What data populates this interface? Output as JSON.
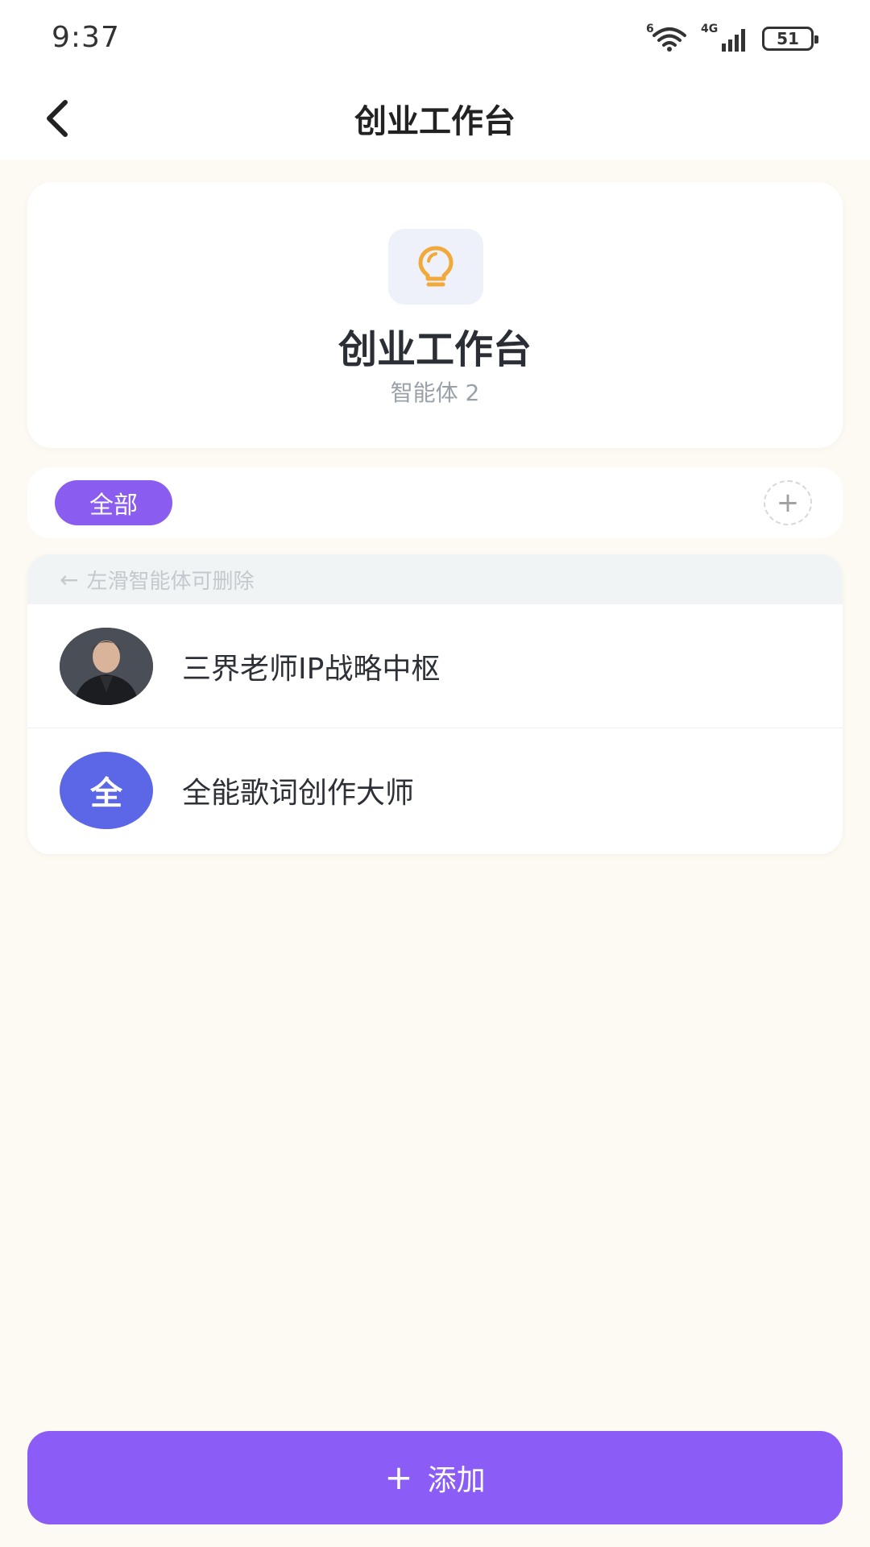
{
  "status_bar": {
    "time": "9:37",
    "wifi_label": "6",
    "network_label": "4G",
    "battery": "51"
  },
  "header": {
    "title": "创业工作台",
    "back_icon": "chevron-left-icon"
  },
  "hero": {
    "icon": "lightbulb-icon",
    "title": "创业工作台",
    "subtitle": "智能体 2"
  },
  "filter": {
    "chips": [
      {
        "label": "全部",
        "selected": true
      }
    ],
    "add_icon": "plus-icon",
    "add_symbol": "+"
  },
  "list": {
    "hint_arrow": "←",
    "hint": "左滑智能体可删除",
    "items": [
      {
        "name": "三界老师IP战略中枢",
        "avatar_type": "photo"
      },
      {
        "name": "全能歌词创作大师",
        "avatar_type": "letter",
        "avatar_letter": "全"
      }
    ]
  },
  "add_button": {
    "symbol": "+",
    "label": "添加"
  },
  "colors": {
    "accent": "#8b5cf6",
    "avatar_letter_bg": "#5b67e6",
    "bulb": "#f2a93b",
    "background": "#fdf9f3"
  }
}
